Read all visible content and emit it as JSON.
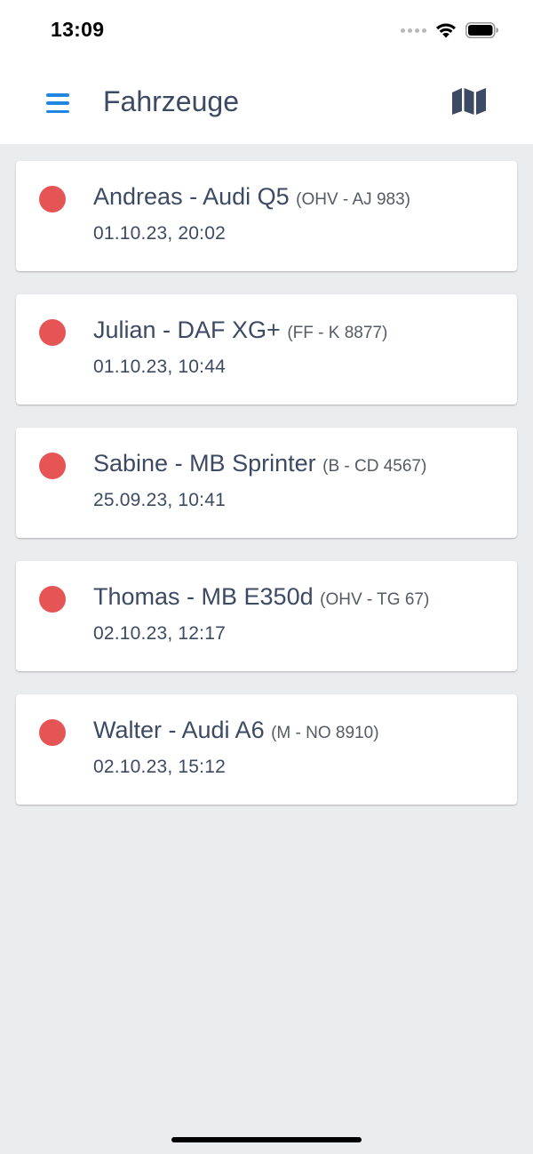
{
  "status_bar": {
    "time": "13:09"
  },
  "header": {
    "title": "Fahrzeuge",
    "menu_icon": "hamburger-menu-icon",
    "map_icon": "map-icon",
    "accent_color": "#2186e0",
    "text_color": "#3c4a63"
  },
  "vehicles": [
    {
      "name": "Andreas - Audi Q5",
      "plate": "(OHV - AJ 983)",
      "date": "01.10.23, 20:02",
      "status_color": "#e65555"
    },
    {
      "name": "Julian - DAF XG+",
      "plate": "(FF - K 8877)",
      "date": "01.10.23, 10:44",
      "status_color": "#e65555"
    },
    {
      "name": "Sabine - MB Sprinter",
      "plate": "(B - CD 4567)",
      "date": "25.09.23, 10:41",
      "status_color": "#e65555"
    },
    {
      "name": "Thomas - MB E350d",
      "plate": "(OHV - TG 67)",
      "date": "02.10.23, 12:17",
      "status_color": "#e65555"
    },
    {
      "name": "Walter - Audi A6",
      "plate": "(M - NO 8910)",
      "date": "02.10.23, 15:12",
      "status_color": "#e65555"
    }
  ]
}
